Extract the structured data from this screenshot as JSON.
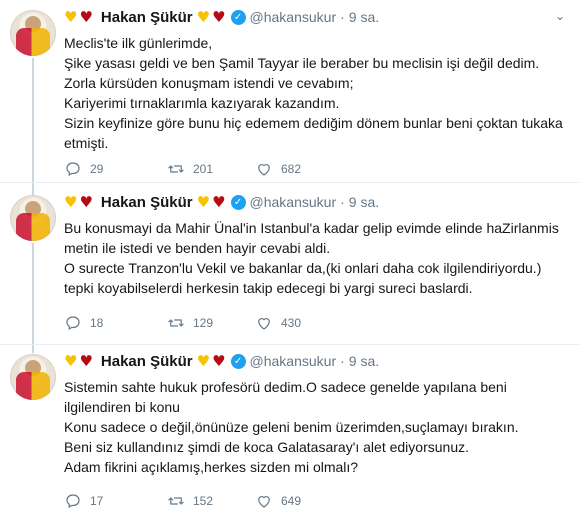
{
  "tweets": [
    {
      "name": "Hakan Şükür",
      "handle": "@hakansukur",
      "separator": "·",
      "time": "9 sa.",
      "lines": [
        "Meclis'te ilk günlerimde,",
        "Şike yasası geldi ve ben Şamil Tayyar ile beraber bu meclisin işi değil dedim.",
        "Zorla kürsüden konuşmam istendi ve cevabım;",
        "Kariyerimi tırnaklarımla kazıyarak kazandım.",
        "Sizin keyfinize göre bunu hiç edemem dediğim dönem bunlar beni çoktan tukaka",
        "etmişti."
      ],
      "replies": "29",
      "retweets": "201",
      "likes": "682"
    },
    {
      "name": "Hakan Şükür",
      "handle": "@hakansukur",
      "separator": "·",
      "time": "9 sa.",
      "lines": [
        "Bu konusmayi da Mahir Ünal'in Istanbul'a kadar gelip evimde elinde haZirlanmis",
        "metin ile istedi ve benden hayir cevabi aldi.",
        "O surecte Tranzon'lu Vekil ve bakanlar da,(ki onlari daha cok ilgilendiriyordu.)",
        "tepki koyabilselerdi herkesin takip edecegi bi yargi sureci baslardi."
      ],
      "replies": "18",
      "retweets": "129",
      "likes": "430"
    },
    {
      "name": "Hakan Şükür",
      "handle": "@hakansukur",
      "separator": "·",
      "time": "9 sa.",
      "lines": [
        "Sistemin sahte hukuk profesörü dedim.O sadece genelde yapılana beni",
        "ilgilendiren bi konu",
        "Konu sadece o değil,önünüze geleni benim üzerimden,suçlamayı bırakın.",
        "Beni siz kullandınız şimdi de koca Galatasaray'ı alet ediyorsunuz.",
        "Adam fikrini açıklamış,herkes sizden mi olmalı?"
      ],
      "replies": "17",
      "retweets": "152",
      "likes": "649"
    }
  ],
  "icons": {
    "reply": "reply-icon",
    "retweet": "retweet-icon",
    "like": "heart-icon",
    "more": "chevron-down-icon",
    "verified": "verified-badge-icon"
  },
  "colors": {
    "text": "#14171a",
    "secondary": "#657786",
    "verified": "#1da1f2",
    "divider": "#e6ecf0",
    "thread": "#ccd6dd"
  }
}
